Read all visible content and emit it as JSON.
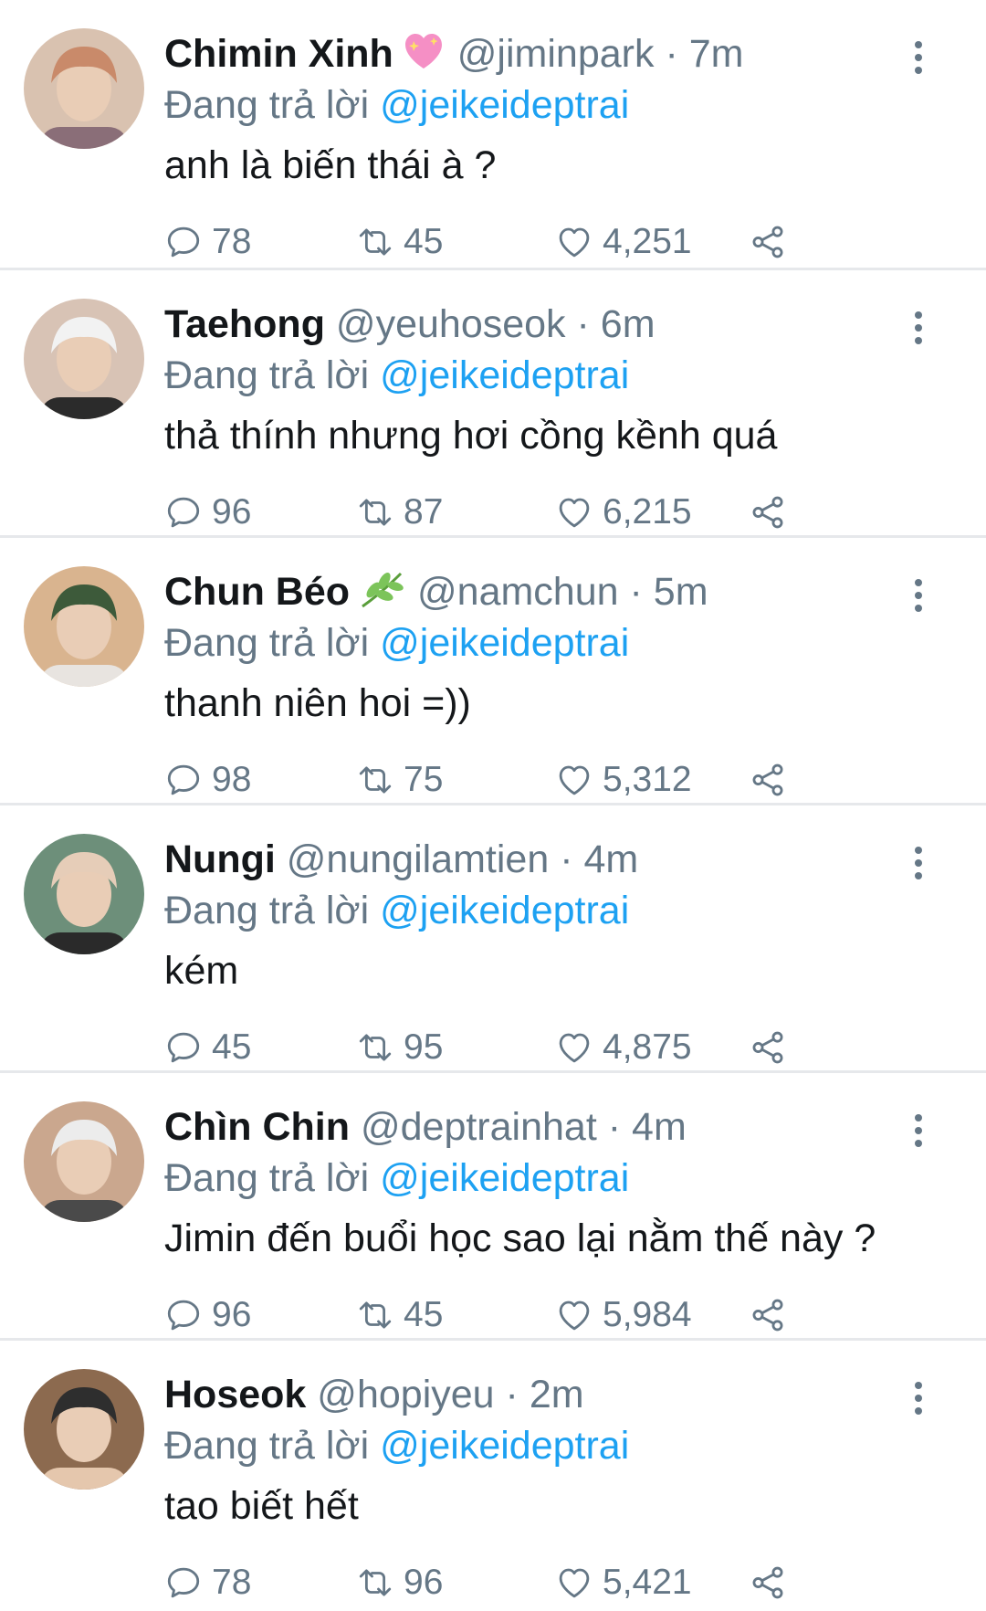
{
  "reply_prefix": "Đang trả lời",
  "tweets": [
    {
      "name": "Chimin Xinh",
      "emoji": "sparkling-heart",
      "handle": "@jiminpark",
      "sep": "·",
      "time": "7m",
      "mention": "@jeikeideptrai",
      "text": "anh là biến thái à ?",
      "replies": "78",
      "retweets": "45",
      "likes": "4,251",
      "avatar_colors": [
        "#c98a6a",
        "#8a6e78",
        "#d9c2b0"
      ]
    },
    {
      "name": "Taehong",
      "emoji": "",
      "handle": "@yeuhoseok",
      "sep": "·",
      "time": "6m",
      "mention": "@jeikeideptrai",
      "text": "thả thính nhưng hơi cồng kềnh quá",
      "replies": "96",
      "retweets": "87",
      "likes": "6,215",
      "avatar_colors": [
        "#f2f2f2",
        "#2b2b2b",
        "#d8c3b5"
      ]
    },
    {
      "name": "Chun Béo",
      "emoji": "herb",
      "handle": "@namchun",
      "sep": "·",
      "time": "5m",
      "mention": "@jeikeideptrai",
      "text": "thanh niên hoi =))",
      "replies": "98",
      "retweets": "75",
      "likes": "5,312",
      "avatar_colors": [
        "#3d5a3a",
        "#e8e4e0",
        "#d9b48f"
      ]
    },
    {
      "name": "Nungi",
      "emoji": "",
      "handle": "@nungilamtien",
      "sep": "·",
      "time": "4m",
      "mention": "@jeikeideptrai",
      "text": "kém",
      "replies": "45",
      "retweets": "95",
      "likes": "4,875",
      "avatar_colors": [
        "#e6cdb8",
        "#2a2a2a",
        "#6d8f7a"
      ]
    },
    {
      "name": "Chìn Chin",
      "emoji": "",
      "handle": "@deptrainhat",
      "sep": "·",
      "time": "4m",
      "mention": "@jeikeideptrai",
      "text": "Jimin đến buổi học sao lại nằm thế này ?",
      "replies": "96",
      "retweets": "45",
      "likes": "5,984",
      "avatar_colors": [
        "#ececec",
        "#4a4a4a",
        "#caa78e"
      ]
    },
    {
      "name": "Hoseok",
      "emoji": "",
      "handle": "@hopiyeu",
      "sep": "·",
      "time": "2m",
      "mention": "@jeikeideptrai",
      "text": "tao biết hết",
      "replies": "78",
      "retweets": "96",
      "likes": "5,421",
      "avatar_colors": [
        "#2e2e2e",
        "#e5c7ad",
        "#8c6a4f"
      ]
    }
  ],
  "colors": {
    "muted": "#657786",
    "link": "#1da1f2",
    "text": "#14171a",
    "divider": "#e6e8eb"
  }
}
